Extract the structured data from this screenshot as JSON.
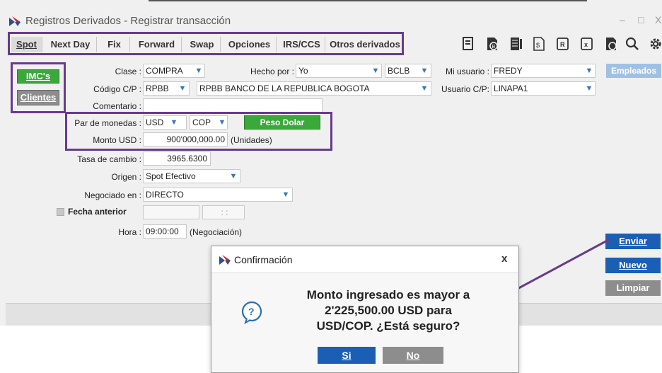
{
  "window": {
    "title": "Registros Derivados - Registrar transacción",
    "min": "–",
    "max": "□",
    "close": "X"
  },
  "tabs": [
    {
      "label": "Spot"
    },
    {
      "label": "Next Day"
    },
    {
      "label": "Fix"
    },
    {
      "label": "Forward"
    },
    {
      "label": "Swap"
    },
    {
      "label": "Opciones"
    },
    {
      "label": "IRS/CCS"
    },
    {
      "label": "Otros derivados"
    }
  ],
  "left_buttons": {
    "imcs": "IMC's",
    "clientes": "Clientes"
  },
  "form": {
    "clase_label": "Clase :",
    "clase_value": "COMPRA",
    "hecho_por_label": "Hecho por :",
    "hecho_por_value": "Yo",
    "hecho_por_code": "BCLB",
    "mi_usuario_label": "Mi usuario :",
    "mi_usuario_value": "FREDY",
    "empleados": "Empleados",
    "codigo_label": "Código C/P :",
    "codigo_value": "RPBB",
    "codigo_desc": "RPBB BANCO DE LA REPUBLICA  BOGOTA",
    "usuario_cp_label": "Usuario C/P:",
    "usuario_cp_value": "LINAPA1",
    "comentario_label": "Comentario :",
    "par_label": "Par de monedas :",
    "par_from": "USD",
    "par_to": "COP",
    "peso_dolar": "Peso Dolar",
    "monto_label": "Monto USD :",
    "monto_value": "900'000,000.00",
    "monto_unit": "(Unidades)",
    "tasa_label": "Tasa de cambio :",
    "tasa_value": "3965.6300",
    "origen_label": "Origen :",
    "origen_value": "Spot Efectivo",
    "negociado_label": "Negociado en :",
    "negociado_value": "DIRECTO",
    "fecha_anterior_label": "Fecha anterior",
    "fecha_time": ": :",
    "hora_label": "Hora :",
    "hora_value": "09:00:00",
    "hora_note": "(Negociación)"
  },
  "side_buttons": {
    "enviar": "Enviar",
    "nuevo": "Nuevo",
    "limpiar": "Limpiar"
  },
  "dialog": {
    "title": "Confirmación",
    "close": "x",
    "line1": "Monto ingresado es mayor a",
    "line2": "2'225,500.00 USD para",
    "line3": "USD/COP. ¿Está seguro?",
    "yes": "Si",
    "no": "No"
  },
  "colors": {
    "accent_purple": "#6a3a8e",
    "green": "#3ba83b",
    "blue_button": "#1a5fb4",
    "gray_button": "#8d8d8d"
  }
}
